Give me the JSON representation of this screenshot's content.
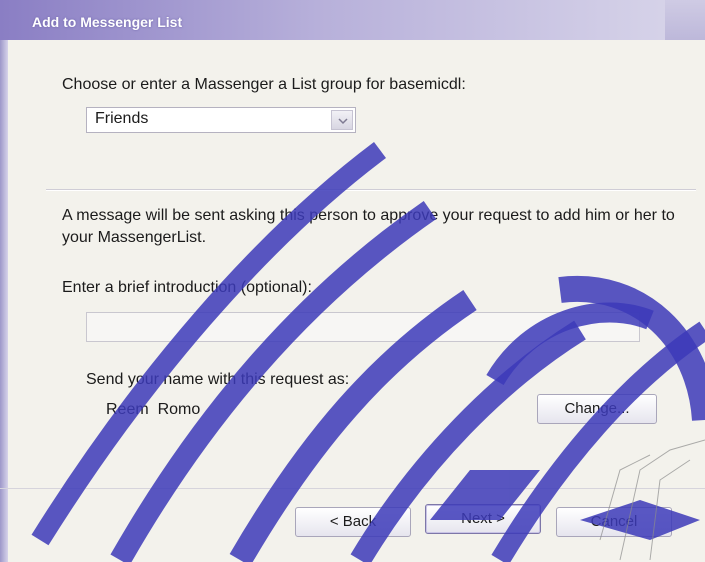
{
  "window": {
    "title": "Add to Messenger List"
  },
  "group_section": {
    "prompt": "Choose or enter a Massenger a List group for basemicdl:",
    "selected_group": "Friends"
  },
  "message_section": {
    "notice": "A message will be sent asking this person to approve your request to add him or her to your MassengerList.",
    "intro_label": "Enter a brief introduction (optional):",
    "intro_value": ""
  },
  "sender_section": {
    "send_as_label": "Send your name with this request as:",
    "sender_name": "Reem  Romo",
    "change_button": "Change..."
  },
  "footer": {
    "back_button": "< Back",
    "next_button": "Next >",
    "cancel_button": "Cancel"
  },
  "colors": {
    "titlebar_start": "#8a7ec4",
    "watermark": "#3c3ab8",
    "dialog_background": "#f3f2ec"
  }
}
